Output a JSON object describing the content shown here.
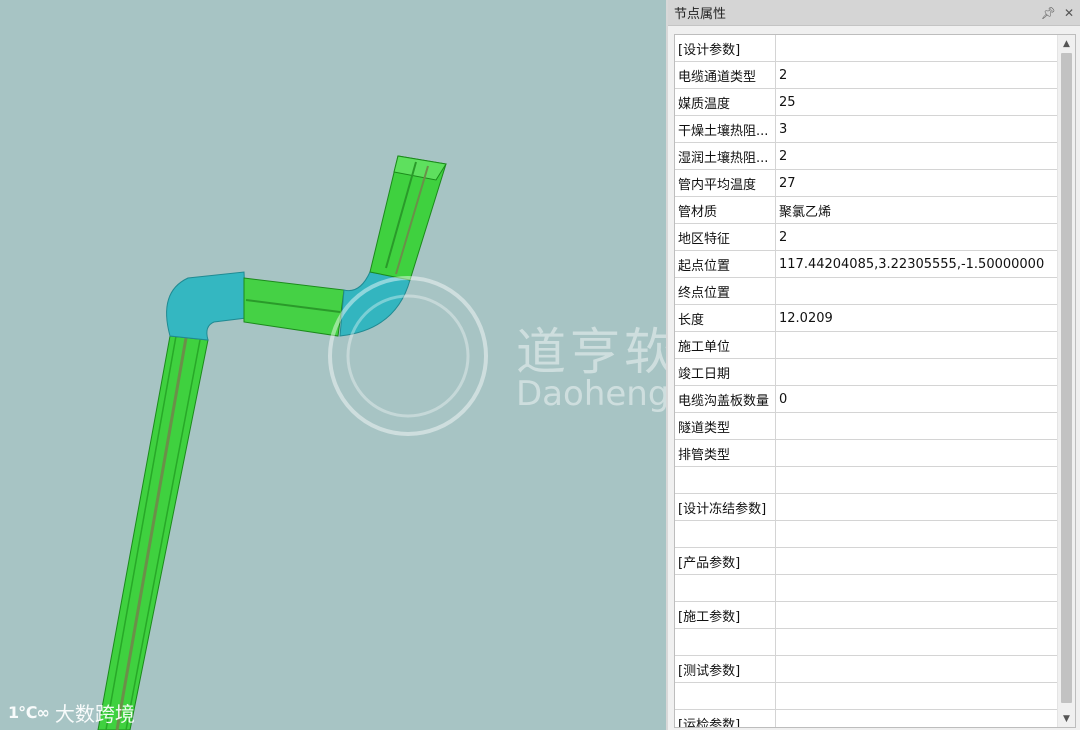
{
  "viewport": {
    "watermark_cn": "道亨软件",
    "watermark_en": "Daohengsoftware",
    "bottom_logo_mark": "1℃∞",
    "bottom_logo_text": "大数跨境"
  },
  "panel": {
    "title": "节点属性",
    "pin_icon": "pin-icon",
    "close_icon": "close-icon",
    "rows": [
      {
        "key": "[设计参数]",
        "value": ""
      },
      {
        "key": "电缆通道类型",
        "value": "2"
      },
      {
        "key": "媒质温度",
        "value": "25"
      },
      {
        "key": "干燥土壤热阻...",
        "value": "3"
      },
      {
        "key": "湿润土壤热阻...",
        "value": "2"
      },
      {
        "key": "管内平均温度",
        "value": "27"
      },
      {
        "key": "管材质",
        "value": "聚氯乙烯"
      },
      {
        "key": "地区特征",
        "value": "2"
      },
      {
        "key": "起点位置",
        "value": "117.44204085,3.22305555,-1.50000000"
      },
      {
        "key": "终点位置",
        "value": ""
      },
      {
        "key": "长度",
        "value": "12.0209"
      },
      {
        "key": "施工单位",
        "value": ""
      },
      {
        "key": "竣工日期",
        "value": ""
      },
      {
        "key": "电缆沟盖板数量",
        "value": "0"
      },
      {
        "key": "隧道类型",
        "value": ""
      },
      {
        "key": "排管类型",
        "value": ""
      },
      {
        "key": "",
        "value": ""
      },
      {
        "key": "[设计冻结参数]",
        "value": ""
      },
      {
        "key": "",
        "value": ""
      },
      {
        "key": "[产品参数]",
        "value": ""
      },
      {
        "key": "",
        "value": ""
      },
      {
        "key": "[施工参数]",
        "value": ""
      },
      {
        "key": "",
        "value": ""
      },
      {
        "key": "[测试参数]",
        "value": ""
      },
      {
        "key": "",
        "value": ""
      },
      {
        "key": "[运检参数]",
        "value": ""
      }
    ]
  },
  "colors": {
    "background": "#a7c4c4",
    "pipe_green": "#3bd43b",
    "pipe_cyan": "#2fb6c0"
  }
}
